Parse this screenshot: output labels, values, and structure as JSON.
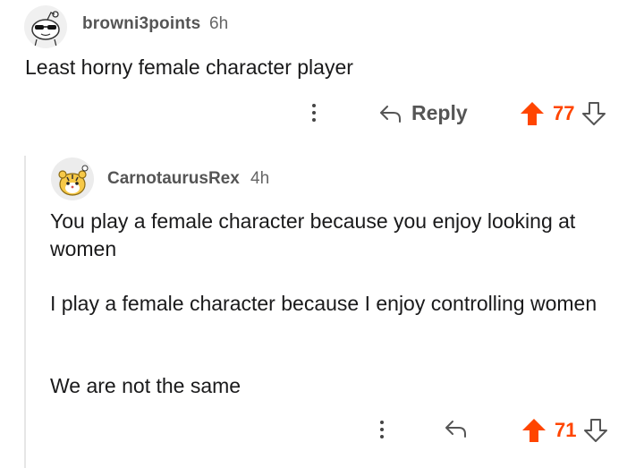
{
  "comments": [
    {
      "username": "browni3points",
      "time": "6h",
      "body": "Least horny female character player",
      "reply_label": "Reply",
      "score": "77",
      "avatar_icon": "snoo-sunglasses-avatar",
      "accent": "#ff4500"
    },
    {
      "username": "CarnotaurusRex",
      "time": "4h",
      "paragraphs": [
        "You play a female character because you enjoy looking at women",
        "I play a female character because I enjoy controlling women",
        "We are not the same"
      ],
      "score": "71",
      "avatar_icon": "snoo-tiger-avatar",
      "accent": "#ff4500"
    }
  ]
}
